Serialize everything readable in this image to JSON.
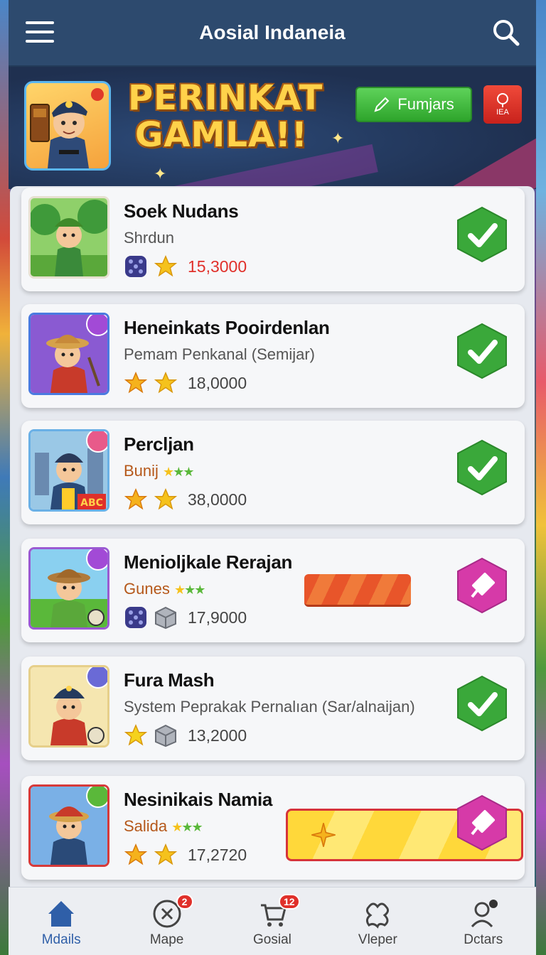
{
  "header": {
    "title": "Aosial Indaneia"
  },
  "banner": {
    "title_line1": "PERINKAT",
    "title_line2": "GAMLA!!",
    "action_button": "Fumjars",
    "red_button_text": "IEA"
  },
  "players": [
    {
      "name": "Soek Nudans",
      "subtitle": "Shrdun",
      "score": "15,3000",
      "score_color": "#e0302a",
      "status": "check"
    },
    {
      "name": "Heneinkats Pooirdenlan",
      "subtitle": "Pemam Penkanal (Semijar)",
      "score": "18,0000",
      "status": "check"
    },
    {
      "name": "Percljan",
      "subtitle": "Bunij",
      "score": "38,0000",
      "status": "check"
    },
    {
      "name": "Menioljkale Rerajan",
      "subtitle": "Gunes",
      "score": "17,9000",
      "status": "pin",
      "progress": 0.5
    },
    {
      "name": "Fura Mash",
      "subtitle": "System Peprakak Pernalıan (Sar/alnaijan)",
      "score": "13,2000",
      "status": "check"
    },
    {
      "name": "Nesinikais Namia",
      "subtitle": "Salida",
      "score": "17,2720",
      "status": "pin",
      "progress": 0.75
    }
  ],
  "thumb_labels": {
    "abc": "ABC"
  },
  "nav": [
    {
      "label": "Mdails",
      "icon": "home-icon",
      "badge": ""
    },
    {
      "label": "Mape",
      "icon": "close-circle-icon",
      "badge": "2"
    },
    {
      "label": "Gosial",
      "icon": "cart-icon",
      "badge": "12"
    },
    {
      "label": "Vleper",
      "icon": "puzzle-icon",
      "badge": ""
    },
    {
      "label": "Dctars",
      "icon": "user-icon",
      "badge": ""
    }
  ],
  "colors": {
    "accent": "#2f5fa8",
    "check_green": "#3aa83a",
    "pin_pink": "#d63aa8",
    "topbar": "#2d4a6e"
  }
}
